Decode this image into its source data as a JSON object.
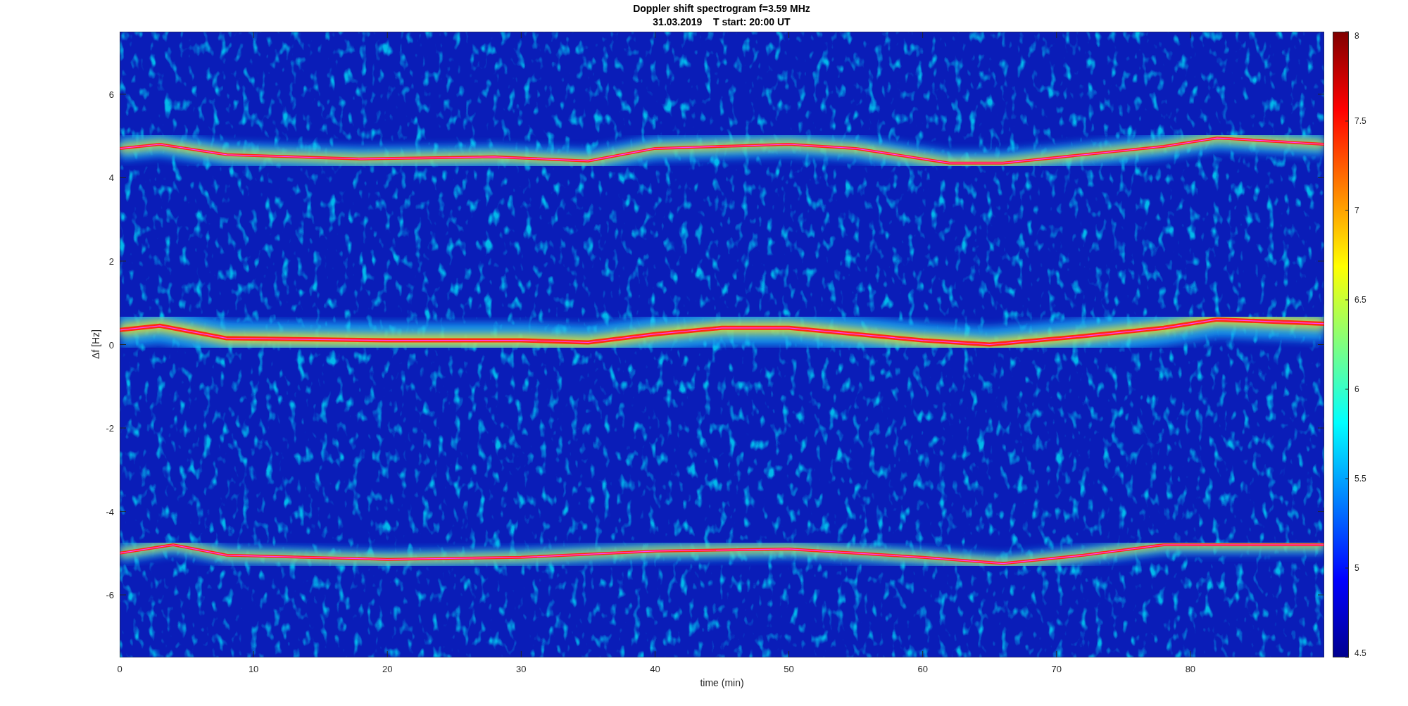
{
  "title": {
    "line_1": "Doppler shift spectrogram f=3.59 MHz",
    "line_2": "31.03.2019    T start: 20:00 UT"
  },
  "x_axis": {
    "label": "time (min)",
    "ticks": [
      "0",
      "10",
      "20",
      "30",
      "40",
      "50",
      "60",
      "70",
      "80"
    ]
  },
  "y_axis": {
    "label": "Δf [Hz]",
    "ticks": [
      "6",
      "4",
      "2",
      "0",
      "-2",
      "-4",
      "-6"
    ]
  },
  "colorbar": {
    "ticks": [
      "8",
      "7.5",
      "7",
      "6.5",
      "6",
      "5.5",
      "5",
      "4.5"
    ]
  }
}
